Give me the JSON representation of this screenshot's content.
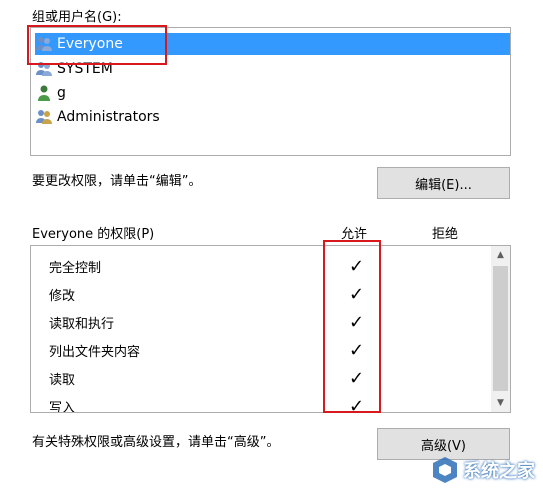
{
  "groups": {
    "label": "组或用户名(G):",
    "items": [
      {
        "name": "Everyone",
        "selected": true
      },
      {
        "name": "SYSTEM",
        "selected": false
      },
      {
        "name": "g",
        "selected": false
      },
      {
        "name": "Administrators",
        "selected": false
      }
    ]
  },
  "edit_hint": "要更改权限，请单击“编辑”。",
  "edit_button": "编辑(E)...",
  "permissions": {
    "label": "Everyone 的权限(P)",
    "allow_header": "允许",
    "deny_header": "拒绝",
    "items": [
      {
        "name": "完全控制",
        "allow": "✓"
      },
      {
        "name": "修改",
        "allow": "✓"
      },
      {
        "name": "读取和执行",
        "allow": "✓"
      },
      {
        "name": "列出文件夹内容",
        "allow": "✓"
      },
      {
        "name": "读取",
        "allow": "✓"
      },
      {
        "name": "写入",
        "allow": "✓"
      }
    ]
  },
  "advanced_hint": "有关特殊权限或高级设置，请单击“高级”。",
  "advanced_button": "高级(V)",
  "watermark": "系统之家",
  "colors": {
    "selection": "#3399ff",
    "highlight_box": "#d7191e"
  }
}
